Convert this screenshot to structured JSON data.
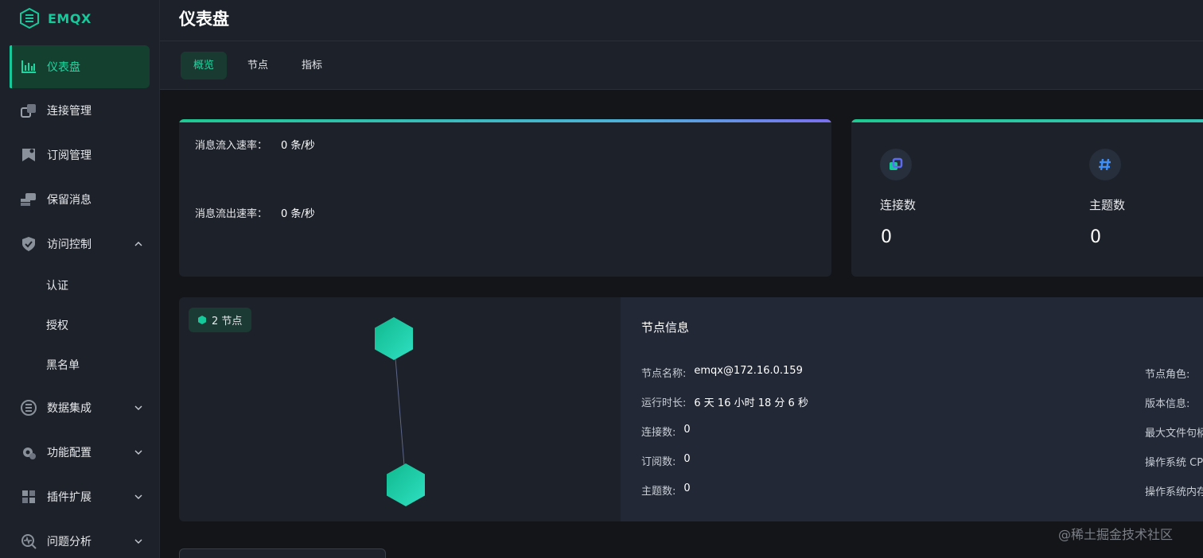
{
  "app": {
    "logo_text": "EMQX",
    "page_title": "仪表盘"
  },
  "sidebar": {
    "items": [
      {
        "label": "仪表盘",
        "icon": "dashboard-icon"
      },
      {
        "label": "连接管理",
        "icon": "connections-icon"
      },
      {
        "label": "订阅管理",
        "icon": "subscriptions-icon"
      },
      {
        "label": "保留消息",
        "icon": "retained-icon"
      },
      {
        "label": "访问控制",
        "icon": "shield-icon"
      },
      {
        "label": "数据集成",
        "icon": "data-integration-icon"
      },
      {
        "label": "功能配置",
        "icon": "gear-icon"
      },
      {
        "label": "插件扩展",
        "icon": "plugin-icon"
      },
      {
        "label": "问题分析",
        "icon": "diagnose-icon"
      }
    ],
    "subitems": [
      "认证",
      "授权",
      "黑名单"
    ]
  },
  "tabs": [
    "概览",
    "节点",
    "指标"
  ],
  "rates": {
    "in_label": "消息流入速率：",
    "in_value": "0 条/秒",
    "out_label": "消息流出速率：",
    "out_value": "0 条/秒"
  },
  "stats": [
    {
      "label": "连接数",
      "value": "0",
      "icon": "connections-icon"
    },
    {
      "label": "主题数",
      "value": "0",
      "icon": "hash-icon"
    }
  ],
  "nodes": {
    "badge": "2 节点",
    "info_title": "节点信息",
    "rows": [
      {
        "key": "节点名称:",
        "value": "emqx@172.16.0.159"
      },
      {
        "key": "运行时长:",
        "value": "6 天 16 小时 18 分 6 秒"
      },
      {
        "key": "连接数:",
        "value": "0"
      },
      {
        "key": "订阅数:",
        "value": "0"
      },
      {
        "key": "主题数:",
        "value": "0"
      }
    ],
    "right_rows": [
      "节点角色:",
      "版本信息:",
      "最大文件句柄",
      "操作系统 CP",
      "操作系统内存"
    ]
  },
  "watermark": "@稀土掘金技术社区",
  "colors": {
    "accent": "#16c99a",
    "sidebar_bg": "#1d2129",
    "page_bg": "#131519"
  }
}
